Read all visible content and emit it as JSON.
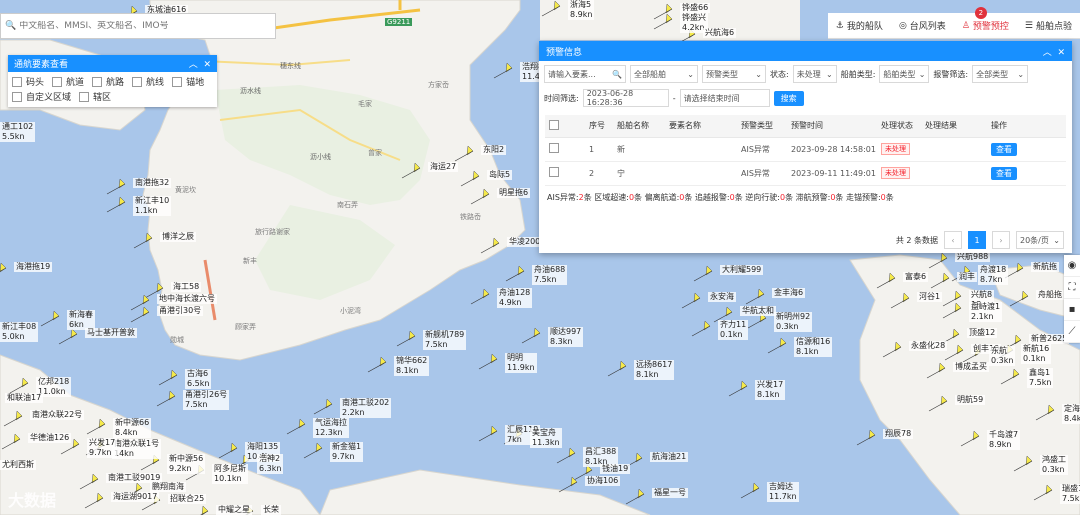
{
  "search": {
    "placeholder": "中文船名、MMSI、英文船名、IMO号"
  },
  "topnav": {
    "items": [
      {
        "label": "我的船队"
      },
      {
        "label": "台风列表"
      },
      {
        "label": "预警预控"
      },
      {
        "label": "船舶点验"
      }
    ],
    "badge": "2"
  },
  "channel": {
    "title": "通航要素查看",
    "options": [
      "码头",
      "航道",
      "航路",
      "航线",
      "锚地",
      "自定义区域",
      "辖区"
    ]
  },
  "warning": {
    "title": "预警信息",
    "filters": {
      "keyword_placeholder": "请输入要素...",
      "ship_scope": "全部船舶",
      "warn_type": "预警类型",
      "status_label": "状态:",
      "status_value": "未处理",
      "ship_type_label": "船舶类型:",
      "ship_type_value": "船舶类型",
      "warn_filter_label": "报警筛选:",
      "warn_filter_value": "全部类型",
      "time_label": "时间筛选:",
      "start_time": "2023-06-28 16:28:36",
      "end_placeholder": "请选择结束时间",
      "search_btn": "搜索"
    },
    "columns": [
      "序号",
      "船舶名称",
      "要素名称",
      "预警类型",
      "预警时间",
      "处理状态",
      "处理结果",
      "操作"
    ],
    "rows": [
      {
        "no": "1",
        "ship": "新",
        "element": "",
        "type": "AIS异常",
        "time": "2023-09-28 14:58:01",
        "status": "未处理",
        "result": "",
        "action": "查看"
      },
      {
        "no": "2",
        "ship": "宁",
        "element": "",
        "type": "AIS异常",
        "time": "2023-09-11 11:49:01",
        "status": "未处理",
        "result": "",
        "action": "查看"
      }
    ],
    "stats": [
      {
        "label": "AIS异常:",
        "n": "2",
        "unit": "条"
      },
      {
        "label": "区域超速:",
        "n": "0",
        "unit": "条"
      },
      {
        "label": "偏离航道:",
        "n": "0",
        "unit": "条"
      },
      {
        "label": "追越报警:",
        "n": "0",
        "unit": "条"
      },
      {
        "label": "逆向行驶:",
        "n": "0",
        "unit": "条"
      },
      {
        "label": "滞航预警:",
        "n": "0",
        "unit": "条"
      },
      {
        "label": "走锚预警:",
        "n": "0",
        "unit": "条"
      }
    ],
    "pager": {
      "total": "共 2 条数据",
      "page": "1",
      "size": "20条/页"
    }
  },
  "map": {
    "places": [
      "方家岙",
      "毛家",
      "中大岙",
      "曾家",
      "黄泥坎",
      "南石弄",
      "铁路岙",
      "旅行路谢家",
      "新丰",
      "小泥湾",
      "顾家弄",
      "勋城",
      "王家岙"
    ],
    "roads": [
      "沥水线",
      "穗东线",
      "沥小线"
    ],
    "highway": "G9211",
    "ships": [
      {
        "name": "东城油616"
      },
      {
        "name": "浙海5",
        "speed": "8.9kn"
      },
      {
        "name": "铧盛66"
      },
      {
        "name": "铧盛兴",
        "speed": "4.2kn"
      },
      {
        "name": "兴航海6"
      },
      {
        "name": "浩翔8",
        "speed": "11.4kn"
      },
      {
        "name": "海运27"
      },
      {
        "name": "东阳2"
      },
      {
        "name": "岛际5"
      },
      {
        "name": "明星拖6"
      },
      {
        "name": "华凌200"
      },
      {
        "name": "舟油688",
        "speed": "7.5kn"
      },
      {
        "name": "舟油128",
        "speed": "4.9kn"
      },
      {
        "name": "大利耀599"
      },
      {
        "name": "永安海"
      },
      {
        "name": "金丰海6"
      },
      {
        "name": "华航太和"
      },
      {
        "name": "齐力11",
        "speed": "0.1kn"
      },
      {
        "name": "新明州92",
        "speed": "0.3kn"
      },
      {
        "name": "信源和16",
        "speed": "8.1kn"
      },
      {
        "name": "新舰机789",
        "speed": "7.5kn"
      },
      {
        "name": "顺达997",
        "speed": "8.3kn"
      },
      {
        "name": "锦华662",
        "speed": "8.1kn"
      },
      {
        "name": "明明",
        "speed": "11.9kn"
      },
      {
        "name": "远扬8617",
        "speed": "8.1kn"
      },
      {
        "name": "兴发17",
        "speed": "8.1kn"
      },
      {
        "name": "南港拖32"
      },
      {
        "name": "新江丰10",
        "speed": "1.1kn"
      },
      {
        "name": "博洋之辰"
      },
      {
        "name": "海工58"
      },
      {
        "name": "地中海长渡六号"
      },
      {
        "name": "甬港引30号"
      },
      {
        "name": "新海春",
        "speed": "6kn"
      },
      {
        "name": "马士基开普敦"
      },
      {
        "name": "古海6",
        "speed": "6.5kn"
      },
      {
        "name": "甬港引26号",
        "speed": "7.5kn"
      },
      {
        "name": "亿邦218",
        "speed": "11.0kn"
      },
      {
        "name": "和联油17"
      },
      {
        "name": "南港众联22号"
      },
      {
        "name": "新中源66",
        "speed": "8.4kn"
      },
      {
        "name": "南港众联1号",
        "speed": "14kn"
      },
      {
        "name": "华德油126"
      },
      {
        "name": "兴发17",
        "speed": "9.7kn"
      },
      {
        "name": "新中源56",
        "speed": "9.2kn"
      },
      {
        "name": "海阳135",
        "speed": "10.4kn"
      },
      {
        "name": "浩神2",
        "speed": "6.3kn"
      },
      {
        "name": "阿多尼斯",
        "speed": "10.1kn"
      },
      {
        "name": "南港工驳202",
        "speed": "2.2kn"
      },
      {
        "name": "气运海拉",
        "speed": "12.3kn"
      },
      {
        "name": "新金猫1",
        "speed": "9.7kn"
      },
      {
        "name": "汇辰118",
        "speed": "7kn"
      },
      {
        "name": "美宝舟",
        "speed": "11.3kn"
      },
      {
        "name": "昌汇388",
        "speed": "8.1kn"
      },
      {
        "name": "航海油21"
      },
      {
        "name": "钱油19"
      },
      {
        "name": "协海106"
      },
      {
        "name": "福星一号"
      },
      {
        "name": "吉姆达",
        "speed": "11.7kn"
      },
      {
        "name": "南港工驳9019"
      },
      {
        "name": "鹏翔南海"
      },
      {
        "name": "海运湖9017"
      },
      {
        "name": "招联合25"
      },
      {
        "name": "中耀之星"
      },
      {
        "name": "长荣"
      },
      {
        "name": "尤利西斯"
      },
      {
        "name": "通工102",
        "speed": "5.5kn"
      },
      {
        "name": "海港拖19"
      },
      {
        "name": "新江丰08",
        "speed": "5.0kn"
      },
      {
        "name": "兴航988"
      },
      {
        "name": "舟渡18",
        "speed": "8.7kn"
      },
      {
        "name": "富泰6"
      },
      {
        "name": "润丰"
      },
      {
        "name": "河谷1"
      },
      {
        "name": "兴航8",
        "speed": "18"
      },
      {
        "name": "盘峙渡1",
        "speed": "2.1kn"
      },
      {
        "name": "顶盛12"
      },
      {
        "name": "永盛化28"
      },
      {
        "name": "创丰10"
      },
      {
        "name": "博成孟买"
      },
      {
        "name": "鑫岛1",
        "speed": "7.5kn"
      },
      {
        "name": "新普2625"
      },
      {
        "name": "新航16",
        "speed": "0.1kn"
      },
      {
        "name": "舟船拖"
      },
      {
        "name": "新航拖"
      },
      {
        "name": "明航59"
      },
      {
        "name": "翔辰78"
      },
      {
        "name": "千岛渡7",
        "speed": "8.9kn"
      },
      {
        "name": "定海",
        "speed": "8.4kn"
      },
      {
        "name": "瑞盛1",
        "speed": "7.5kn"
      },
      {
        "name": "鸿盛工",
        "speed": "0.3kn"
      },
      {
        "name": "东航",
        "speed": "0.3kn"
      }
    ]
  },
  "watermark": "大数据"
}
